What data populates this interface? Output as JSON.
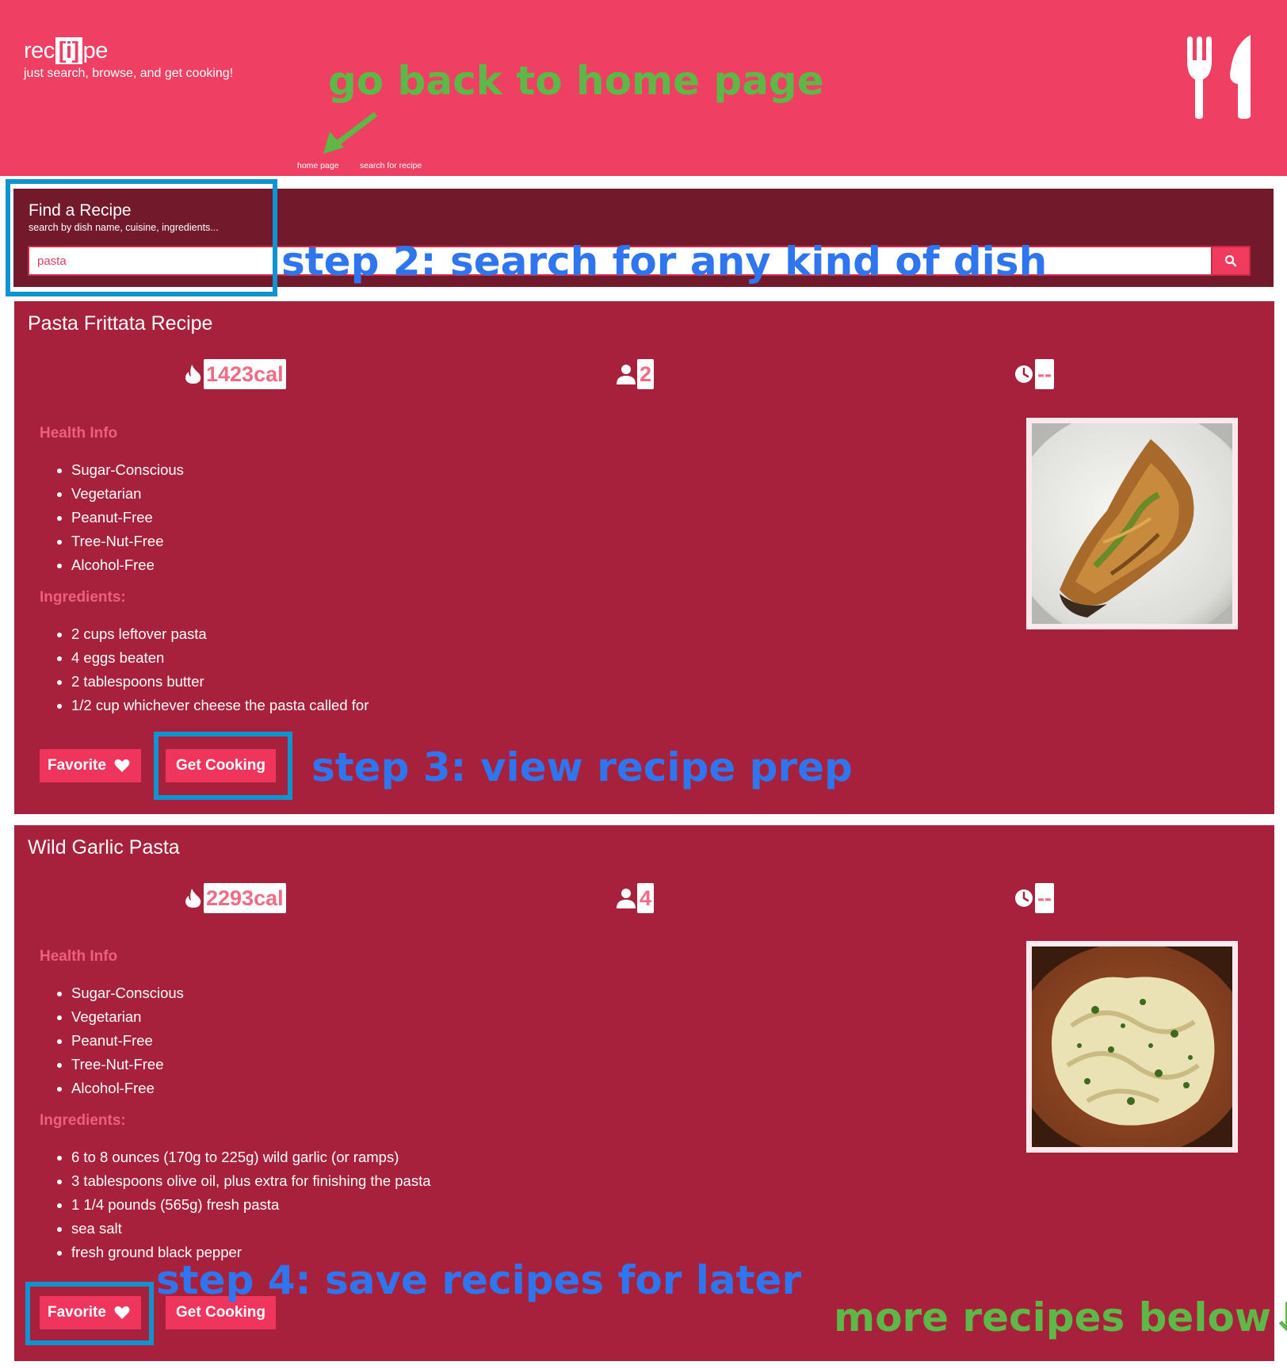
{
  "header": {
    "logo_pre": "rec",
    "logo_box": "[i]",
    "logo_post": "pe",
    "tagline": "just search, browse, and get cooking!",
    "nav_home": "home page",
    "nav_search": "search for recipe",
    "brand_color": "#ef3f62"
  },
  "annotations": {
    "home": "go back to home page",
    "step2": "step 2: search for any kind of dish",
    "step3": "step 3: view recipe prep",
    "step4": "step 4: save recipes for later",
    "more": "more recipes below↓"
  },
  "search": {
    "title": "Find a Recipe",
    "subtitle": "search by dish name, cuisine, ingredients...",
    "value": "pasta",
    "button_icon": "search-icon"
  },
  "labels": {
    "health_info": "Health Info",
    "ingredients": "Ingredients:",
    "favorite": "Favorite",
    "get_cooking": "Get Cooking"
  },
  "recipes": [
    {
      "title": "Pasta Frittata Recipe",
      "calories": "1423cal",
      "servings": "2",
      "time": "--",
      "health": [
        "Sugar-Conscious",
        "Vegetarian",
        "Peanut-Free",
        "Tree-Nut-Free",
        "Alcohol-Free"
      ],
      "ingredients": [
        "2 cups leftover pasta",
        "4 eggs beaten",
        "2 tablespoons butter",
        "1/2 cup whichever cheese the pasta called for"
      ]
    },
    {
      "title": "Wild Garlic Pasta",
      "calories": "2293cal",
      "servings": "4",
      "time": "--",
      "health": [
        "Sugar-Conscious",
        "Vegetarian",
        "Peanut-Free",
        "Tree-Nut-Free",
        "Alcohol-Free"
      ],
      "ingredients": [
        "6 to 8 ounces (170g to 225g) wild garlic (or ramps)",
        "3 tablespoons olive oil, plus extra for finishing the pasta",
        "1 1/4 pounds (565g) fresh pasta",
        "sea salt",
        "fresh ground black pepper"
      ]
    }
  ],
  "colors": {
    "card": "#a8213c",
    "search_panel": "#72192c",
    "button": "#f0355c",
    "annotation_blue": "#2f76ee",
    "annotation_green": "#5eb847",
    "frame_blue": "#0f94d1"
  }
}
